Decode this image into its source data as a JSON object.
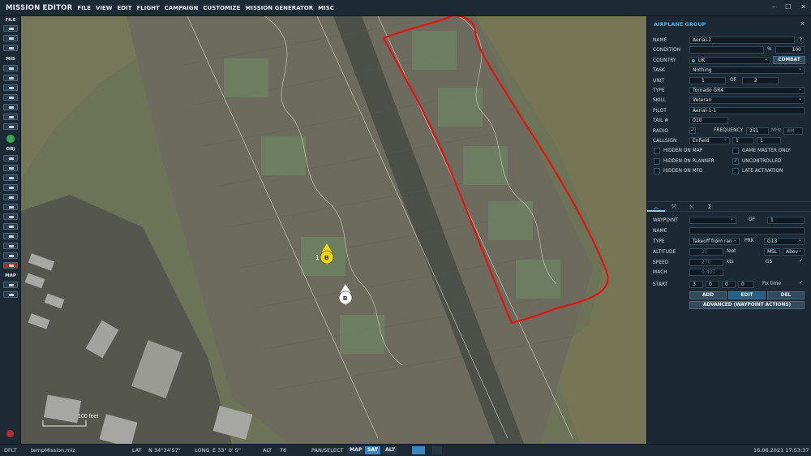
{
  "window": {
    "title": "MISSION EDITOR",
    "minimize": "–",
    "maximize": "☐",
    "close": "✕"
  },
  "menu": [
    "FILE",
    "VIEW",
    "EDIT",
    "FLIGHT",
    "CAMPAIGN",
    "CUSTOMIZE",
    "MISSION GENERATOR",
    "MISC"
  ],
  "toolbar": {
    "file_label": "FILE",
    "mis_label": "MIS",
    "obj_label": "OBJ",
    "map_label": "MAP"
  },
  "map": {
    "scale_label": "100 feet",
    "unit_index": "1",
    "unit_b1_label": "B",
    "unit_b2_label": "B",
    "colors": {
      "grass": "#5f6a4e",
      "apron": "#6b6a5c",
      "taxiway": "#4f5247",
      "highlight": "#e01010",
      "unit_selected": "#f2d615",
      "unit_other": "#ffffff"
    }
  },
  "panel": {
    "title": "AIRPLANE GROUP",
    "help_label": "?",
    "close_label": "✕",
    "name_label": "NAME",
    "name_value": "Aerial-1",
    "condition_label": "CONDITION",
    "condition_value": "",
    "percent_label": "%",
    "probability": "100",
    "country_label": "COUNTRY",
    "country_value": "UK",
    "combat_label": "COMBAT",
    "task_label": "TASK",
    "task_value": "Nothing",
    "unit_label": "UNIT",
    "unit_value": "1",
    "of_label": "OF",
    "unit_total": "2",
    "type_label": "TYPE",
    "type_value": "Tornado GR4",
    "skill_label": "SKILL",
    "skill_value": "Veteran",
    "pilot_label": "PILOT",
    "pilot_value": "Aerial-1-1",
    "tail_label": "TAIL #",
    "tail_value": "010",
    "radio_label": "RADIO",
    "frequency_label": "FREQUENCY",
    "frequency_value": "251",
    "mhz_label": "MHz",
    "modulation": "AM",
    "callsign_label": "CALLSIGN",
    "callsign_value": "Enfield",
    "callsign_num1": "1",
    "callsign_num2": "1",
    "checks": {
      "hidden_map": "HIDDEN ON MAP",
      "game_master": "GAME MASTER ONLY",
      "hidden_planner": "HIDDEN ON PLANNER",
      "uncontrolled": "UNCONTROLLED",
      "hidden_mfd": "HIDDEN ON MFD",
      "late_activation": "LATE ACTIVATION",
      "check_mark": "✓"
    },
    "tabs": [
      "︿",
      "⤧",
      "⤬",
      "Σ"
    ],
    "wp": {
      "waypoint_label": "WAYPOINT",
      "waypoint_value": "",
      "of_label": "OF",
      "waypoint_total": "1",
      "name_label": "NAME",
      "name_value": "",
      "type_label": "TYPE",
      "type_value": "Takeoff from ran",
      "prk_label": "PRK",
      "prk_value": "G13",
      "altitude_label": "ALTITUDE",
      "altitude_value": "25",
      "feet_label": "feet",
      "msl_value": "MSL",
      "above_value": "Abov",
      "speed_label": "SPEED",
      "speed_value": "270",
      "kts_label": "kts",
      "gs_label": "GS",
      "mach_label": "MACH",
      "mach_value": "0.407",
      "start_label": "START",
      "start_day": "3",
      "start_h": "0",
      "start_m": "0",
      "start_s": "0",
      "fix_time_label": "Fix time",
      "add_label": "ADD",
      "edit_label": "EDIT",
      "del_label": "DEL",
      "advanced_label": "ADVANCED (WAYPOINT ACTIONS)"
    }
  },
  "status": {
    "mode": "DFLT",
    "file": "tempMission.miz",
    "lat_label": "LAT",
    "lat_value": "N 34°34'57\"",
    "long_label": "LONG",
    "long_value": "E 33° 0' 5\"",
    "alt_label": "ALT",
    "alt_value": "76",
    "pan_select": "PAN/SELECT",
    "map_btn": "MAP",
    "sat_btn": "SAT",
    "alt_btn": "ALT",
    "datetime": "16.06.2021 17:53:37"
  }
}
